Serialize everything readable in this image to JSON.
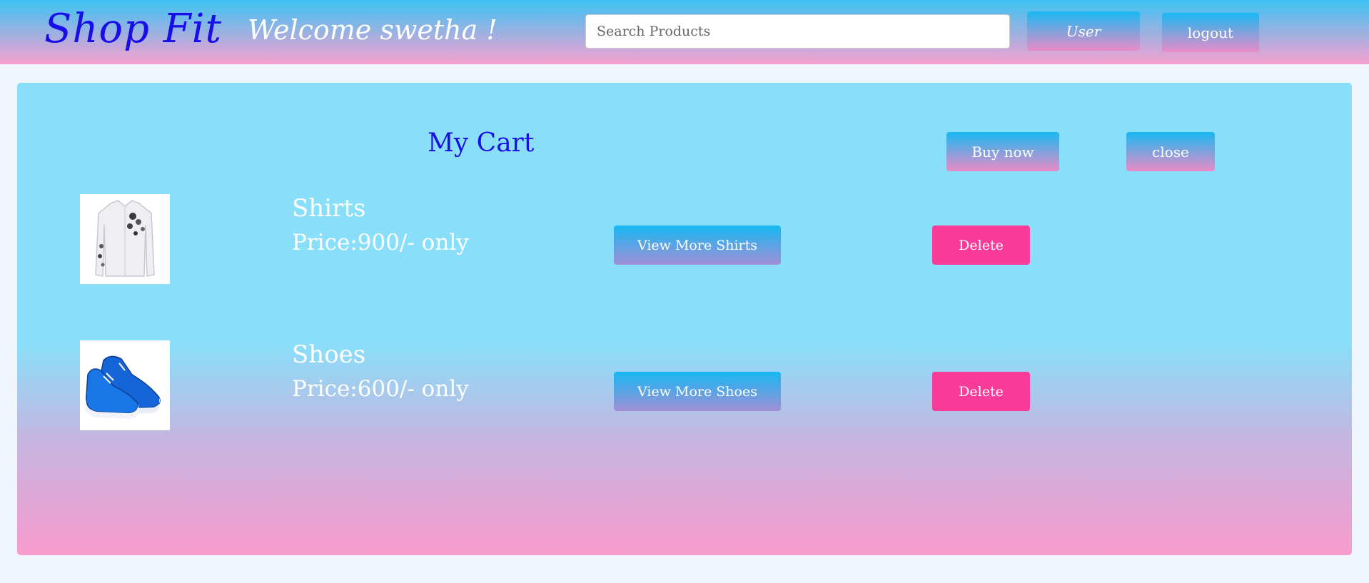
{
  "header": {
    "brand": "Shop Fit",
    "welcome": "Welcome swetha !",
    "search_placeholder": "Search Products",
    "user_label": "User",
    "logout_label": "logout"
  },
  "cart": {
    "title": "My Cart",
    "buy_now_label": "Buy now",
    "close_label": "close",
    "items": [
      {
        "name": "Shirts",
        "price": "Price:900/- only",
        "view_label": "View More Shirts",
        "delete_label": "Delete",
        "image": "white-floral-shirt"
      },
      {
        "name": "Shoes",
        "price": "Price:600/- only",
        "view_label": "View More Shoes",
        "delete_label": "Delete",
        "image": "blue-sneakers"
      }
    ]
  },
  "colors": {
    "brand": "#1a0ee8",
    "delete": "#fa3b9a",
    "panel": "#89dffa",
    "gradient_pink": "#f89ccf"
  }
}
